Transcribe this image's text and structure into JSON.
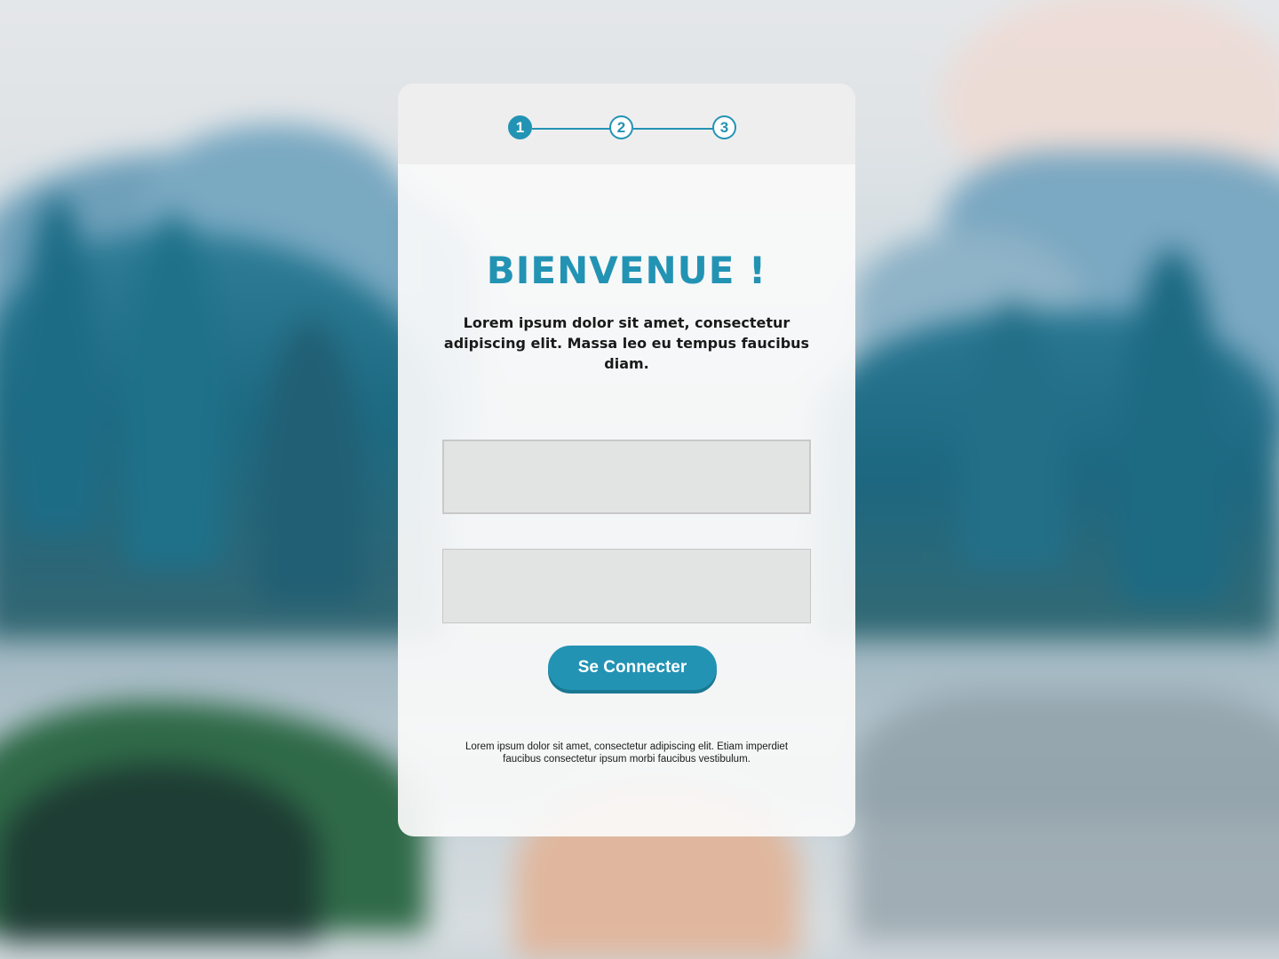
{
  "stepper": {
    "steps": [
      "1",
      "2",
      "3"
    ],
    "active_step": 1,
    "accent_color": "#2393b4"
  },
  "welcome": {
    "title": "BIENVENUE !",
    "intro": "Lorem ipsum dolor sit amet, consectetur adipiscing elit. Massa leo eu tempus faucibus diam."
  },
  "form": {
    "field_1_value": "",
    "field_1_placeholder": "",
    "field_2_value": "",
    "field_2_placeholder": "",
    "submit_label": "Se Connecter"
  },
  "footer": {
    "note": "Lorem ipsum dolor sit amet, consectetur adipiscing elit. Etiam imperdiet faucibus consectetur ipsum morbi faucibus vestibulum."
  },
  "colors": {
    "accent": "#2393b4",
    "card_background": "#fafafa",
    "stepper_background": "#eeeeee",
    "input_background": "#e2e3e3"
  }
}
